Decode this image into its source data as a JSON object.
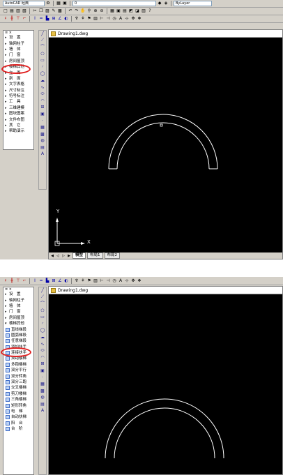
{
  "screen1": {
    "toolbar1": {
      "workspace": "AutoCAD 经典",
      "layer_value": "0",
      "linetype": "ByLayer"
    },
    "menu": [
      {
        "label": "设　置",
        "expanded": false
      },
      {
        "label": "轴网柱子",
        "expanded": false
      },
      {
        "label": "墙　体",
        "expanded": false
      },
      {
        "label": "门　窗",
        "expanded": false
      },
      {
        "label": "房间屋顶",
        "expanded": false
      },
      {
        "label": "楼梯其他",
        "expanded": false
      },
      {
        "label": "立　面",
        "expanded": false
      },
      {
        "label": "剖　面",
        "expanded": false
      },
      {
        "label": "文字表格",
        "expanded": false
      },
      {
        "label": "尺寸标注",
        "expanded": false
      },
      {
        "label": "符号标注",
        "expanded": false
      },
      {
        "label": "工　具",
        "expanded": false
      },
      {
        "label": "三维建模",
        "expanded": false
      },
      {
        "label": "图块图案",
        "expanded": false
      },
      {
        "label": "文件布图",
        "expanded": false
      },
      {
        "label": "其　它",
        "expanded": false
      },
      {
        "label": "帮助演示",
        "expanded": false
      }
    ],
    "drawing": {
      "title": "Drawing1.dwg",
      "ucs_x": "X",
      "ucs_y": "Y",
      "tabs": [
        "模型",
        "布局1",
        "布局2"
      ]
    }
  },
  "screen2": {
    "menu_top": [
      {
        "label": "设　置"
      },
      {
        "label": "轴网柱子"
      },
      {
        "label": "墙　体"
      },
      {
        "label": "门　窗"
      },
      {
        "label": "房间屋顶"
      },
      {
        "label": "楼梯其他"
      }
    ],
    "submenu": [
      "直线梯段",
      "圆弧梯段",
      "任意梯段",
      "添加扶手",
      "连接扶手",
      "双跑楼梯",
      "多跑楼梯",
      "双分平行",
      "双分转角",
      "双分三跑",
      "交叉楼梯",
      "剪刀楼梯",
      "三角楼梯",
      "矩形转角",
      "电　梯",
      "自动扶梯",
      "阳　台",
      "台　阶"
    ],
    "drawing": {
      "title": "Drawing1.dwg"
    }
  },
  "icons": {
    "toolbar1": [
      "new-icon",
      "open-icon",
      "save-icon",
      "print-icon",
      "layer-icon",
      "properties-icon"
    ],
    "draw_tools": [
      "line-icon",
      "xline-icon",
      "polyline-icon",
      "polygon-icon",
      "rectangle-icon",
      "arc-icon",
      "circle-icon",
      "cloud-icon",
      "spline-icon",
      "ellipse-icon",
      "ellipse-arc-icon",
      "insert-block-icon",
      "make-block-icon",
      "point-icon",
      "hatch-icon",
      "gradient-icon",
      "region-icon",
      "table-icon",
      "mtext-icon"
    ]
  },
  "colors": {
    "drawing_bg": "#000000",
    "geometry": "#ffffff",
    "highlight": "#e02020",
    "panel": "#d4d0c8"
  }
}
